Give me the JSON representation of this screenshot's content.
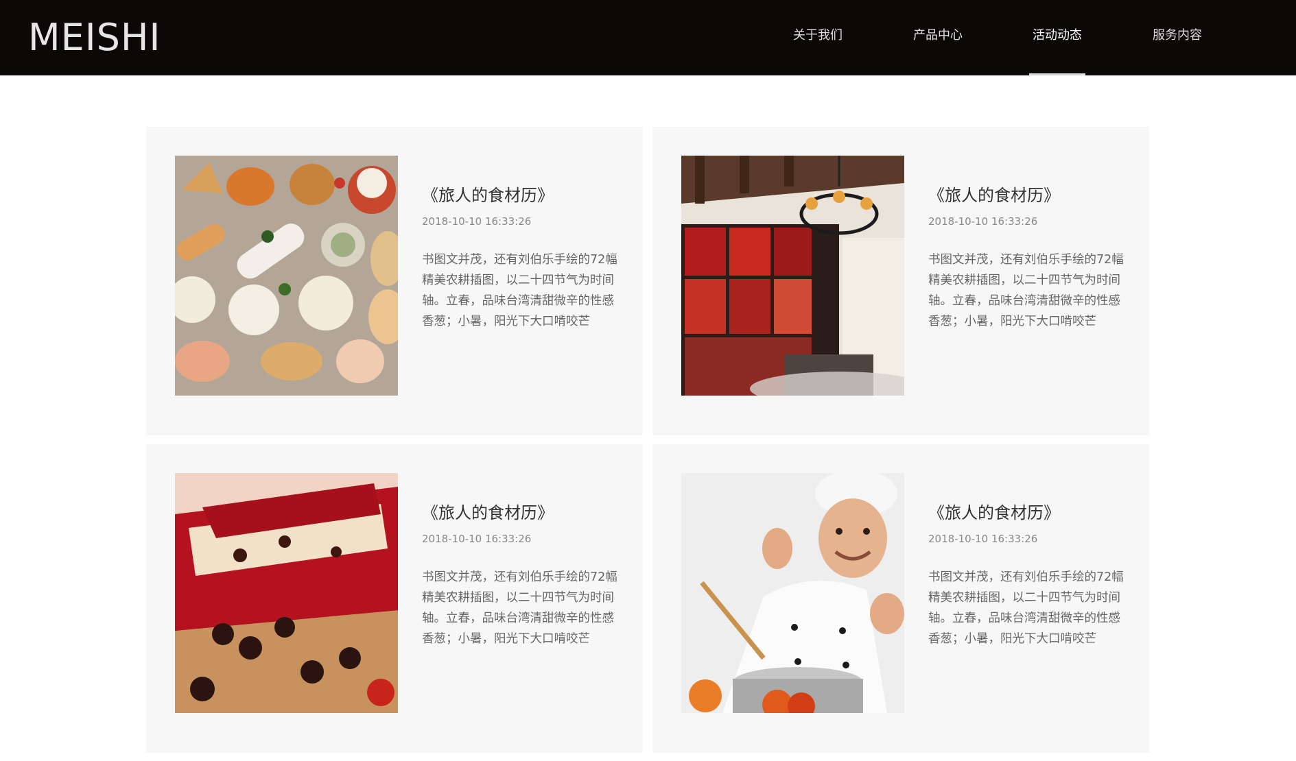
{
  "brand": {
    "logo": "MEISHI"
  },
  "nav": {
    "items": [
      {
        "label": "关于我们",
        "active": false
      },
      {
        "label": "产品中心",
        "active": false
      },
      {
        "label": "活动动态",
        "active": true
      },
      {
        "label": "服务内容",
        "active": false
      }
    ]
  },
  "colors": {
    "header_bg": "#0c0808",
    "card_bg": "#f7f7f7",
    "nav_text": "#e0e0e0"
  },
  "articles": [
    {
      "image": "dim-sum-photo",
      "title": "《旅人的食材历》",
      "date": "2018-10-10 16:33:26",
      "excerpt": "书图文并茂，还有刘伯乐手绘的72幅精美农耕插图，以二十四节气为时间轴。立春，品味台湾清甜微辛的性感香葱；小暑，阳光下大口啃咬芒"
    },
    {
      "image": "restaurant-interior-photo",
      "title": "《旅人的食材历》",
      "date": "2018-10-10 16:33:26",
      "excerpt": "书图文并茂，还有刘伯乐手绘的72幅精美农耕插图，以二十四节气为时间轴。立春，品味台湾清甜微辛的性感香葱；小暑，阳光下大口啃咬芒"
    },
    {
      "image": "red-velvet-cake-photo",
      "title": "《旅人的食材历》",
      "date": "2018-10-10 16:33:26",
      "excerpt": "书图文并茂，还有刘伯乐手绘的72幅精美农耕插图，以二十四节气为时间轴。立春，品味台湾清甜微辛的性感香葱；小暑，阳光下大口啃咬芒"
    },
    {
      "image": "chef-cooking-photo",
      "title": "《旅人的食材历》",
      "date": "2018-10-10 16:33:26",
      "excerpt": "书图文并茂，还有刘伯乐手绘的72幅精美农耕插图，以二十四节气为时间轴。立春，品味台湾清甜微辛的性感香葱；小暑，阳光下大口啃咬芒"
    }
  ]
}
